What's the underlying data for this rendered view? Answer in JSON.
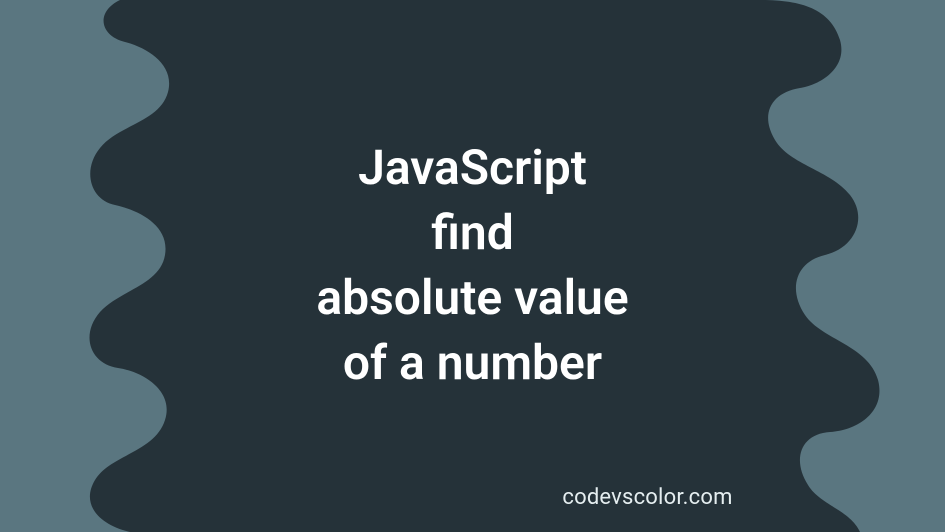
{
  "title": {
    "line1": "JavaScript",
    "line2": "find",
    "line3": "absolute value",
    "line4": "of a number"
  },
  "credit": "codevscolor.com",
  "colors": {
    "background": "#5a7680",
    "blob": "#253239",
    "text": "#ffffff",
    "credit": "#e5eef0"
  }
}
